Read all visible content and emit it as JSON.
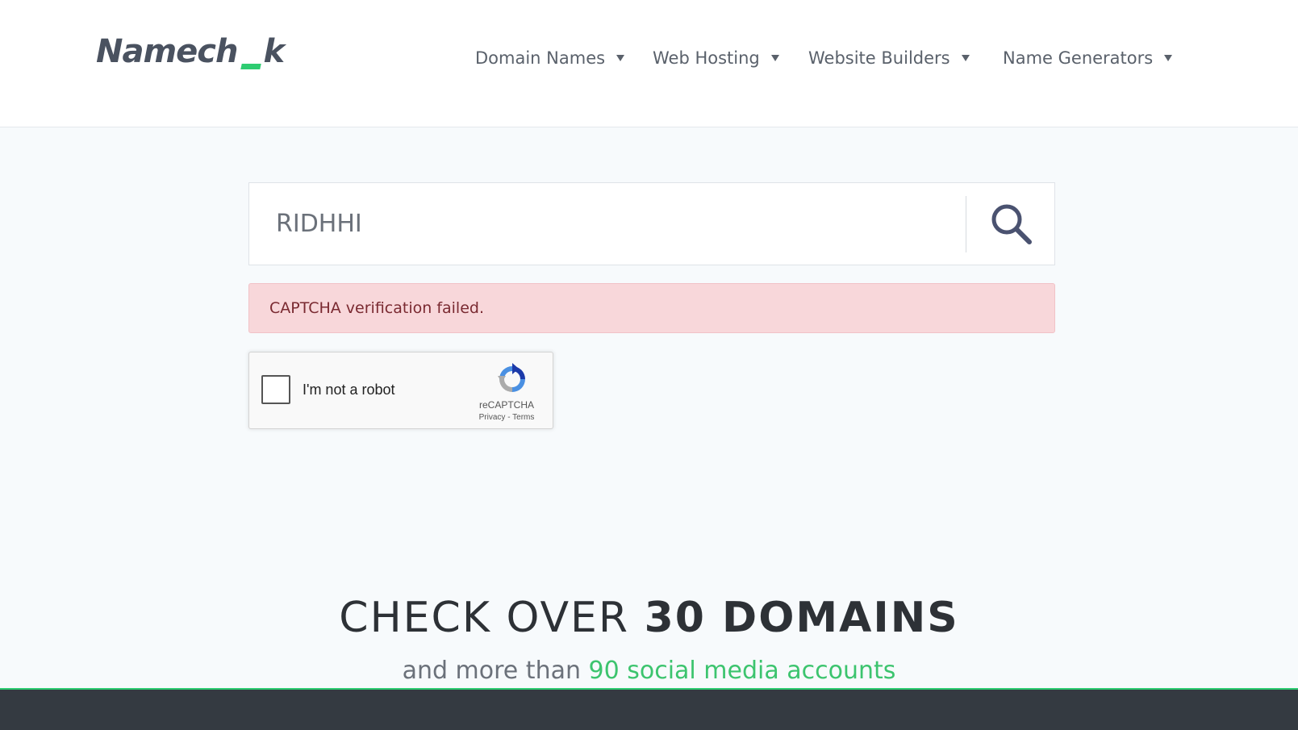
{
  "brand": {
    "logo_left": "Namech",
    "logo_right": "k",
    "accent_color": "#2ecc71"
  },
  "nav": {
    "items": [
      {
        "label": "Domain Names"
      },
      {
        "label": "Web Hosting"
      },
      {
        "label": "Website Builders"
      },
      {
        "label": "Name Generators"
      }
    ]
  },
  "search": {
    "value": "RIDHHI",
    "button_icon": "search-icon"
  },
  "alert": {
    "message": "CAPTCHA verification failed.",
    "color": "#f8d7da"
  },
  "recaptcha": {
    "label": "I'm not a robot",
    "brand": "reCAPTCHA",
    "privacy": "Privacy",
    "separator": " - ",
    "terms": "Terms",
    "checked": false
  },
  "promo": {
    "headline_light": "CHECK OVER ",
    "headline_bold": "30 DOMAINS",
    "sub_prefix": "and more than ",
    "sub_accent": "90 social media accounts"
  }
}
